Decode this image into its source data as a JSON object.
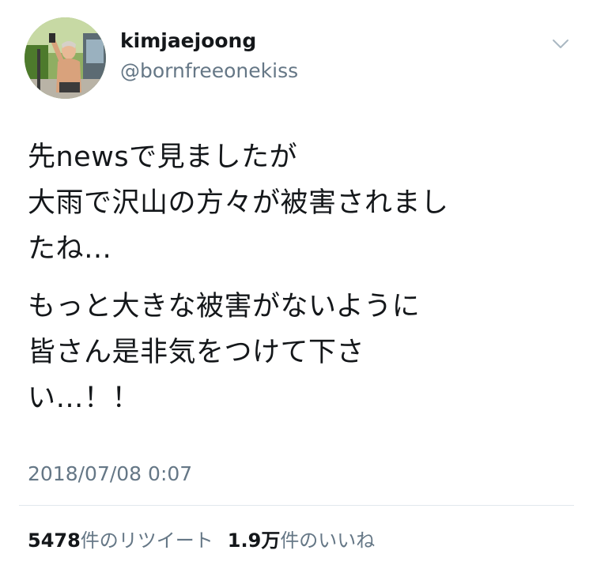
{
  "user": {
    "display_name": "kimjaejoong",
    "handle": "@bornfreeonekiss"
  },
  "icons": {
    "avatar": "profile-photo",
    "menu": "chevron-down-icon"
  },
  "tweet": {
    "paragraph_1": [
      "先newsで見ましたが",
      "大雨で沢山の方々が被害されまし",
      "たね…"
    ],
    "paragraph_2": [
      "もっと大きな被害がないように",
      "皆さん是非気をつけて下さ",
      "い…！！"
    ]
  },
  "timestamp": "2018/07/08 0:07",
  "stats": {
    "retweets_count": "5478",
    "retweets_label": "件のリツイート",
    "likes_count": "1.9万",
    "likes_label": "件のいいね"
  },
  "colors": {
    "text_primary": "#14171a",
    "text_secondary": "#657786",
    "divider": "#e1e8ed"
  }
}
